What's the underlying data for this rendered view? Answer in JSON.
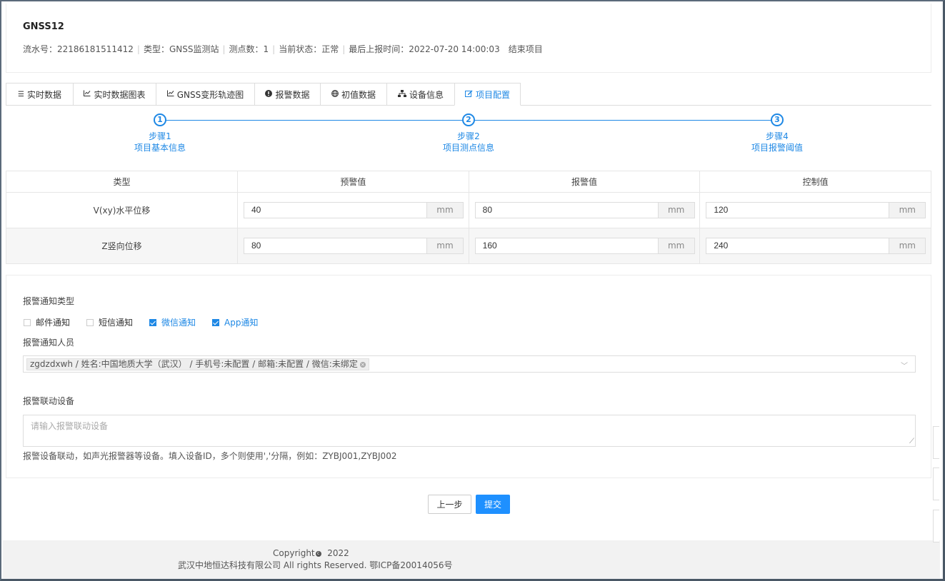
{
  "project": {
    "title": "GNSS12",
    "serial_label": "流水号：22186181511412",
    "type_label": "类型：GNSS监测站",
    "points_label": "测点数：1",
    "status_label": "当前状态：正常",
    "last_report_label": "最后上报时间：2022-07-20 14:00:03",
    "end_label": "结束项目"
  },
  "tabs": [
    {
      "icon": "list-icon",
      "label": "实时数据"
    },
    {
      "icon": "line-chart-icon",
      "label": "实时数据图表"
    },
    {
      "icon": "line-chart-icon",
      "label": "GNSS变形轨迹图"
    },
    {
      "icon": "alert-circle-icon",
      "label": "报警数据"
    },
    {
      "icon": "globe-icon",
      "label": "初值数据"
    },
    {
      "icon": "sitemap-icon",
      "label": "设备信息"
    },
    {
      "icon": "edit-icon",
      "label": "项目配置",
      "active": true
    }
  ],
  "steps": [
    {
      "num": "1",
      "title": "步骤1",
      "desc": "项目基本信息"
    },
    {
      "num": "2",
      "title": "步骤2",
      "desc": "项目测点信息"
    },
    {
      "num": "3",
      "title": "步骤4",
      "desc": "项目报警阈值"
    }
  ],
  "thresholds": {
    "headers": [
      "类型",
      "预警值",
      "报警值",
      "控制值"
    ],
    "unit": "mm",
    "rows": [
      {
        "type": "V(xy)水平位移",
        "warning": "40",
        "alarm": "80",
        "control": "120"
      },
      {
        "type": "Z竖向位移",
        "warning": "80",
        "alarm": "160",
        "control": "240"
      }
    ]
  },
  "notify": {
    "type_title": "报警通知类型",
    "options": [
      {
        "label": "邮件通知",
        "checked": false
      },
      {
        "label": "短信通知",
        "checked": false
      },
      {
        "label": "微信通知",
        "checked": true
      },
      {
        "label": "App通知",
        "checked": true
      }
    ],
    "people_title": "报警通知人员",
    "people_tag": "zgdzdxwh / 姓名:中国地质大学（武汉） / 手机号:未配置 / 邮箱:未配置 / 微信:未绑定",
    "device_title": "报警联动设备",
    "device_placeholder": "请输入报警联动设备",
    "device_hint": "报警设备联动，如声光报警器等设备。填入设备ID，多个则使用','分隔，例如：ZYBJ001,ZYBJ002"
  },
  "buttons": {
    "prev": "上一步",
    "submit": "提交"
  },
  "footer": {
    "copyright": "Copyright",
    "year": "2022",
    "company": "武汉中地恒达科技有限公司 All rights Reserved.  鄂ICP备20014056号"
  },
  "colors": {
    "accent": "#1e88e5",
    "primary_button": "#1e90ff"
  }
}
